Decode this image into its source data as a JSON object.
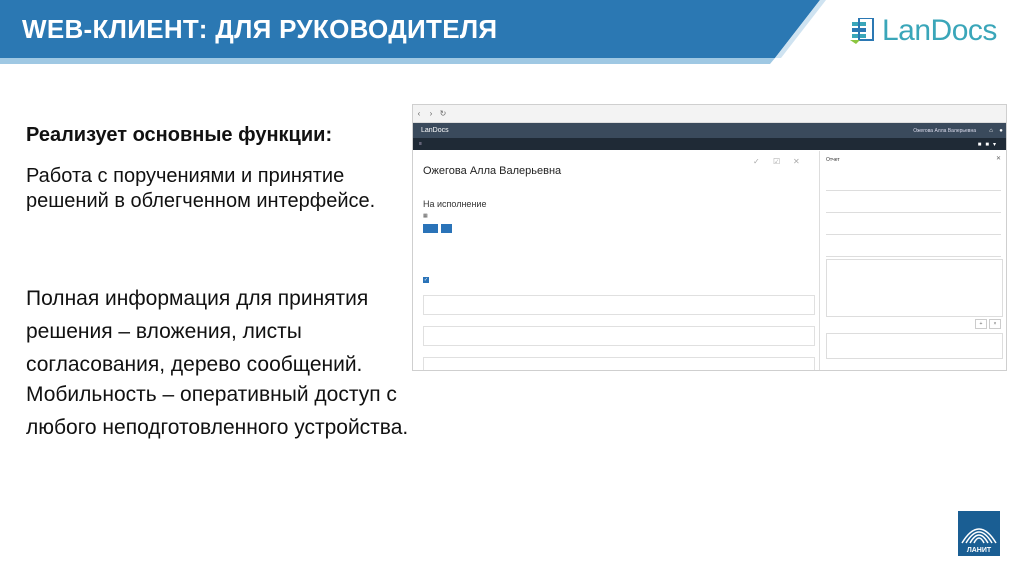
{
  "header": {
    "title": "WEB-КЛИЕНТ: ДЛЯ РУКОВОДИТЕЛЯ",
    "logo_text": "LanDocs",
    "banner_color": "#2b78b3",
    "accent_color": "#3aa6b9"
  },
  "content": {
    "heading": "Реализует основные функции:",
    "paragraph1": "Работа с поручениями и принятие решений в облегченном интерфейсе.",
    "paragraph2": "Полная информация для принятия решения – вложения, листы согласования, дерево сообщений.",
    "paragraph3": "Мобильность – оперативный доступ с любого неподготовленного устройства."
  },
  "footer_logo": {
    "label": "ЛАНИТ"
  },
  "screenshot": {
    "app_brand": "LanDocs",
    "user_name": "Ожегова Алла Валерьевна",
    "section": "На исполнение",
    "panel_title": "Отчет"
  }
}
